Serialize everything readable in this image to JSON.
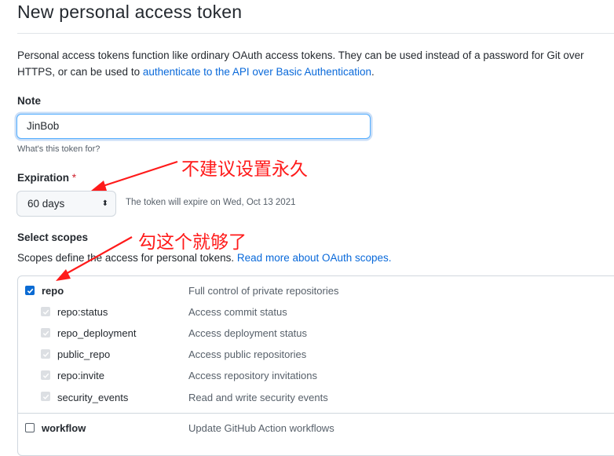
{
  "page": {
    "title": "New personal access token",
    "intro_text": "Personal access tokens function like ordinary OAuth access tokens. They can be used instead of a password for Git over HTTPS, or can be used to ",
    "intro_link": "authenticate to the API over Basic Authentication",
    "intro_end": "."
  },
  "note": {
    "label": "Note",
    "value": "JinBob",
    "hint": "What's this token for?"
  },
  "expiration": {
    "label": "Expiration",
    "required_mark": "*",
    "selected": "60 days",
    "arrows": "⬍",
    "message": "The token will expire on Wed, Oct 13 2021"
  },
  "scopes": {
    "label": "Select scopes",
    "desc_pre": "Scopes define the access for personal tokens. ",
    "desc_link": "Read more about OAuth scopes.",
    "items": [
      {
        "name": "repo",
        "desc": "Full control of private repositories",
        "state": "checked",
        "bold": true
      },
      {
        "name": "repo:status",
        "desc": "Access commit status",
        "state": "disabled",
        "bold": false
      },
      {
        "name": "repo_deployment",
        "desc": "Access deployment status",
        "state": "disabled",
        "bold": false
      },
      {
        "name": "public_repo",
        "desc": "Access public repositories",
        "state": "disabled",
        "bold": false
      },
      {
        "name": "repo:invite",
        "desc": "Access repository invitations",
        "state": "disabled",
        "bold": false
      },
      {
        "name": "security_events",
        "desc": "Read and write security events",
        "state": "disabled",
        "bold": false
      },
      {
        "name": "workflow",
        "desc": "Update GitHub Action workflows",
        "state": "unchecked",
        "bold": true
      }
    ]
  },
  "annotations": {
    "expiration_note": "不建议设置永久",
    "scope_note": "勾这个就够了",
    "color": "#ff1a1a"
  },
  "colors": {
    "link": "#0969da",
    "checkbox": "#0b6bd3",
    "focus_border": "#54aeff"
  }
}
